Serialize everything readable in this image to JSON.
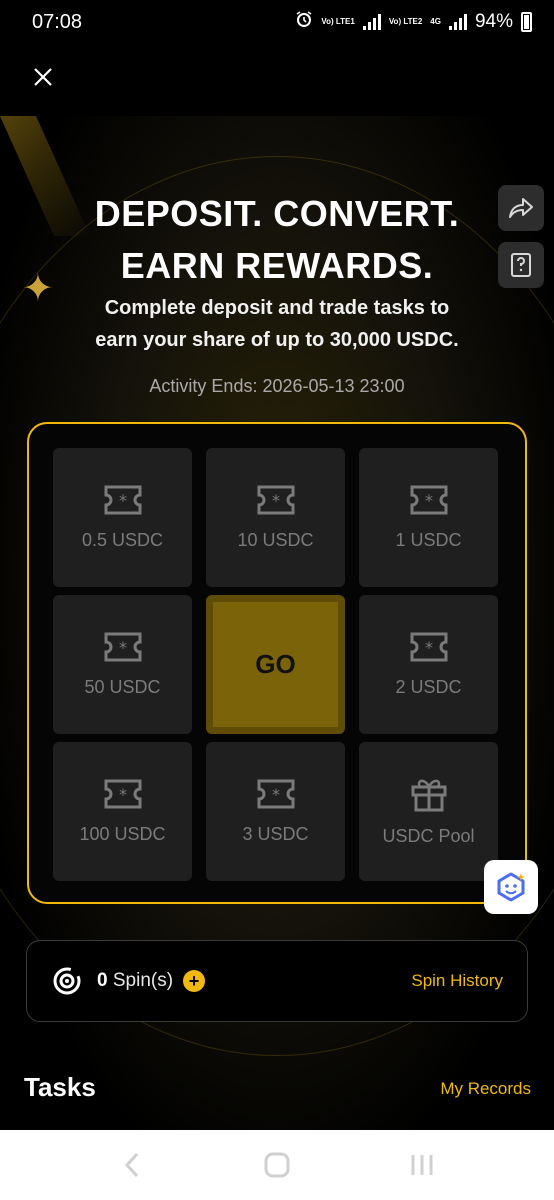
{
  "status": {
    "time": "07:08",
    "sim1": "Vo) LTE1",
    "sim2": "Vo) LTE2",
    "network": "4G",
    "battery": "94%"
  },
  "hero": {
    "headline_line1": "DEPOSIT. CONVERT.",
    "headline_line2": "EARN REWARDS.",
    "subline_line1": "Complete deposit and trade tasks to",
    "subline_line2": "earn your share of up to 30,000 USDC.",
    "activity": "Activity Ends: 2026-05-13 23:00"
  },
  "board": {
    "cells": [
      {
        "label": "0.5 USDC",
        "icon": "ticket-icon"
      },
      {
        "label": "10 USDC",
        "icon": "ticket-icon"
      },
      {
        "label": "1 USDC",
        "icon": "ticket-icon"
      },
      {
        "label": "50 USDC",
        "icon": "ticket-icon"
      },
      {
        "label": "GO",
        "icon": ""
      },
      {
        "label": "2 USDC",
        "icon": "ticket-icon"
      },
      {
        "label": "100 USDC",
        "icon": "ticket-icon"
      },
      {
        "label": "3 USDC",
        "icon": "ticket-icon"
      },
      {
        "label": "USDC Pool",
        "icon": "gift-icon"
      }
    ]
  },
  "spin": {
    "count": "0",
    "unit": " Spin(s)",
    "history": "Spin History"
  },
  "tasks": {
    "title": "Tasks",
    "records": "My Records"
  },
  "colors": {
    "accent": "#f0b90b",
    "background": "#000000",
    "cell": "#1f1f1f",
    "go_cell": "#7a6308"
  }
}
